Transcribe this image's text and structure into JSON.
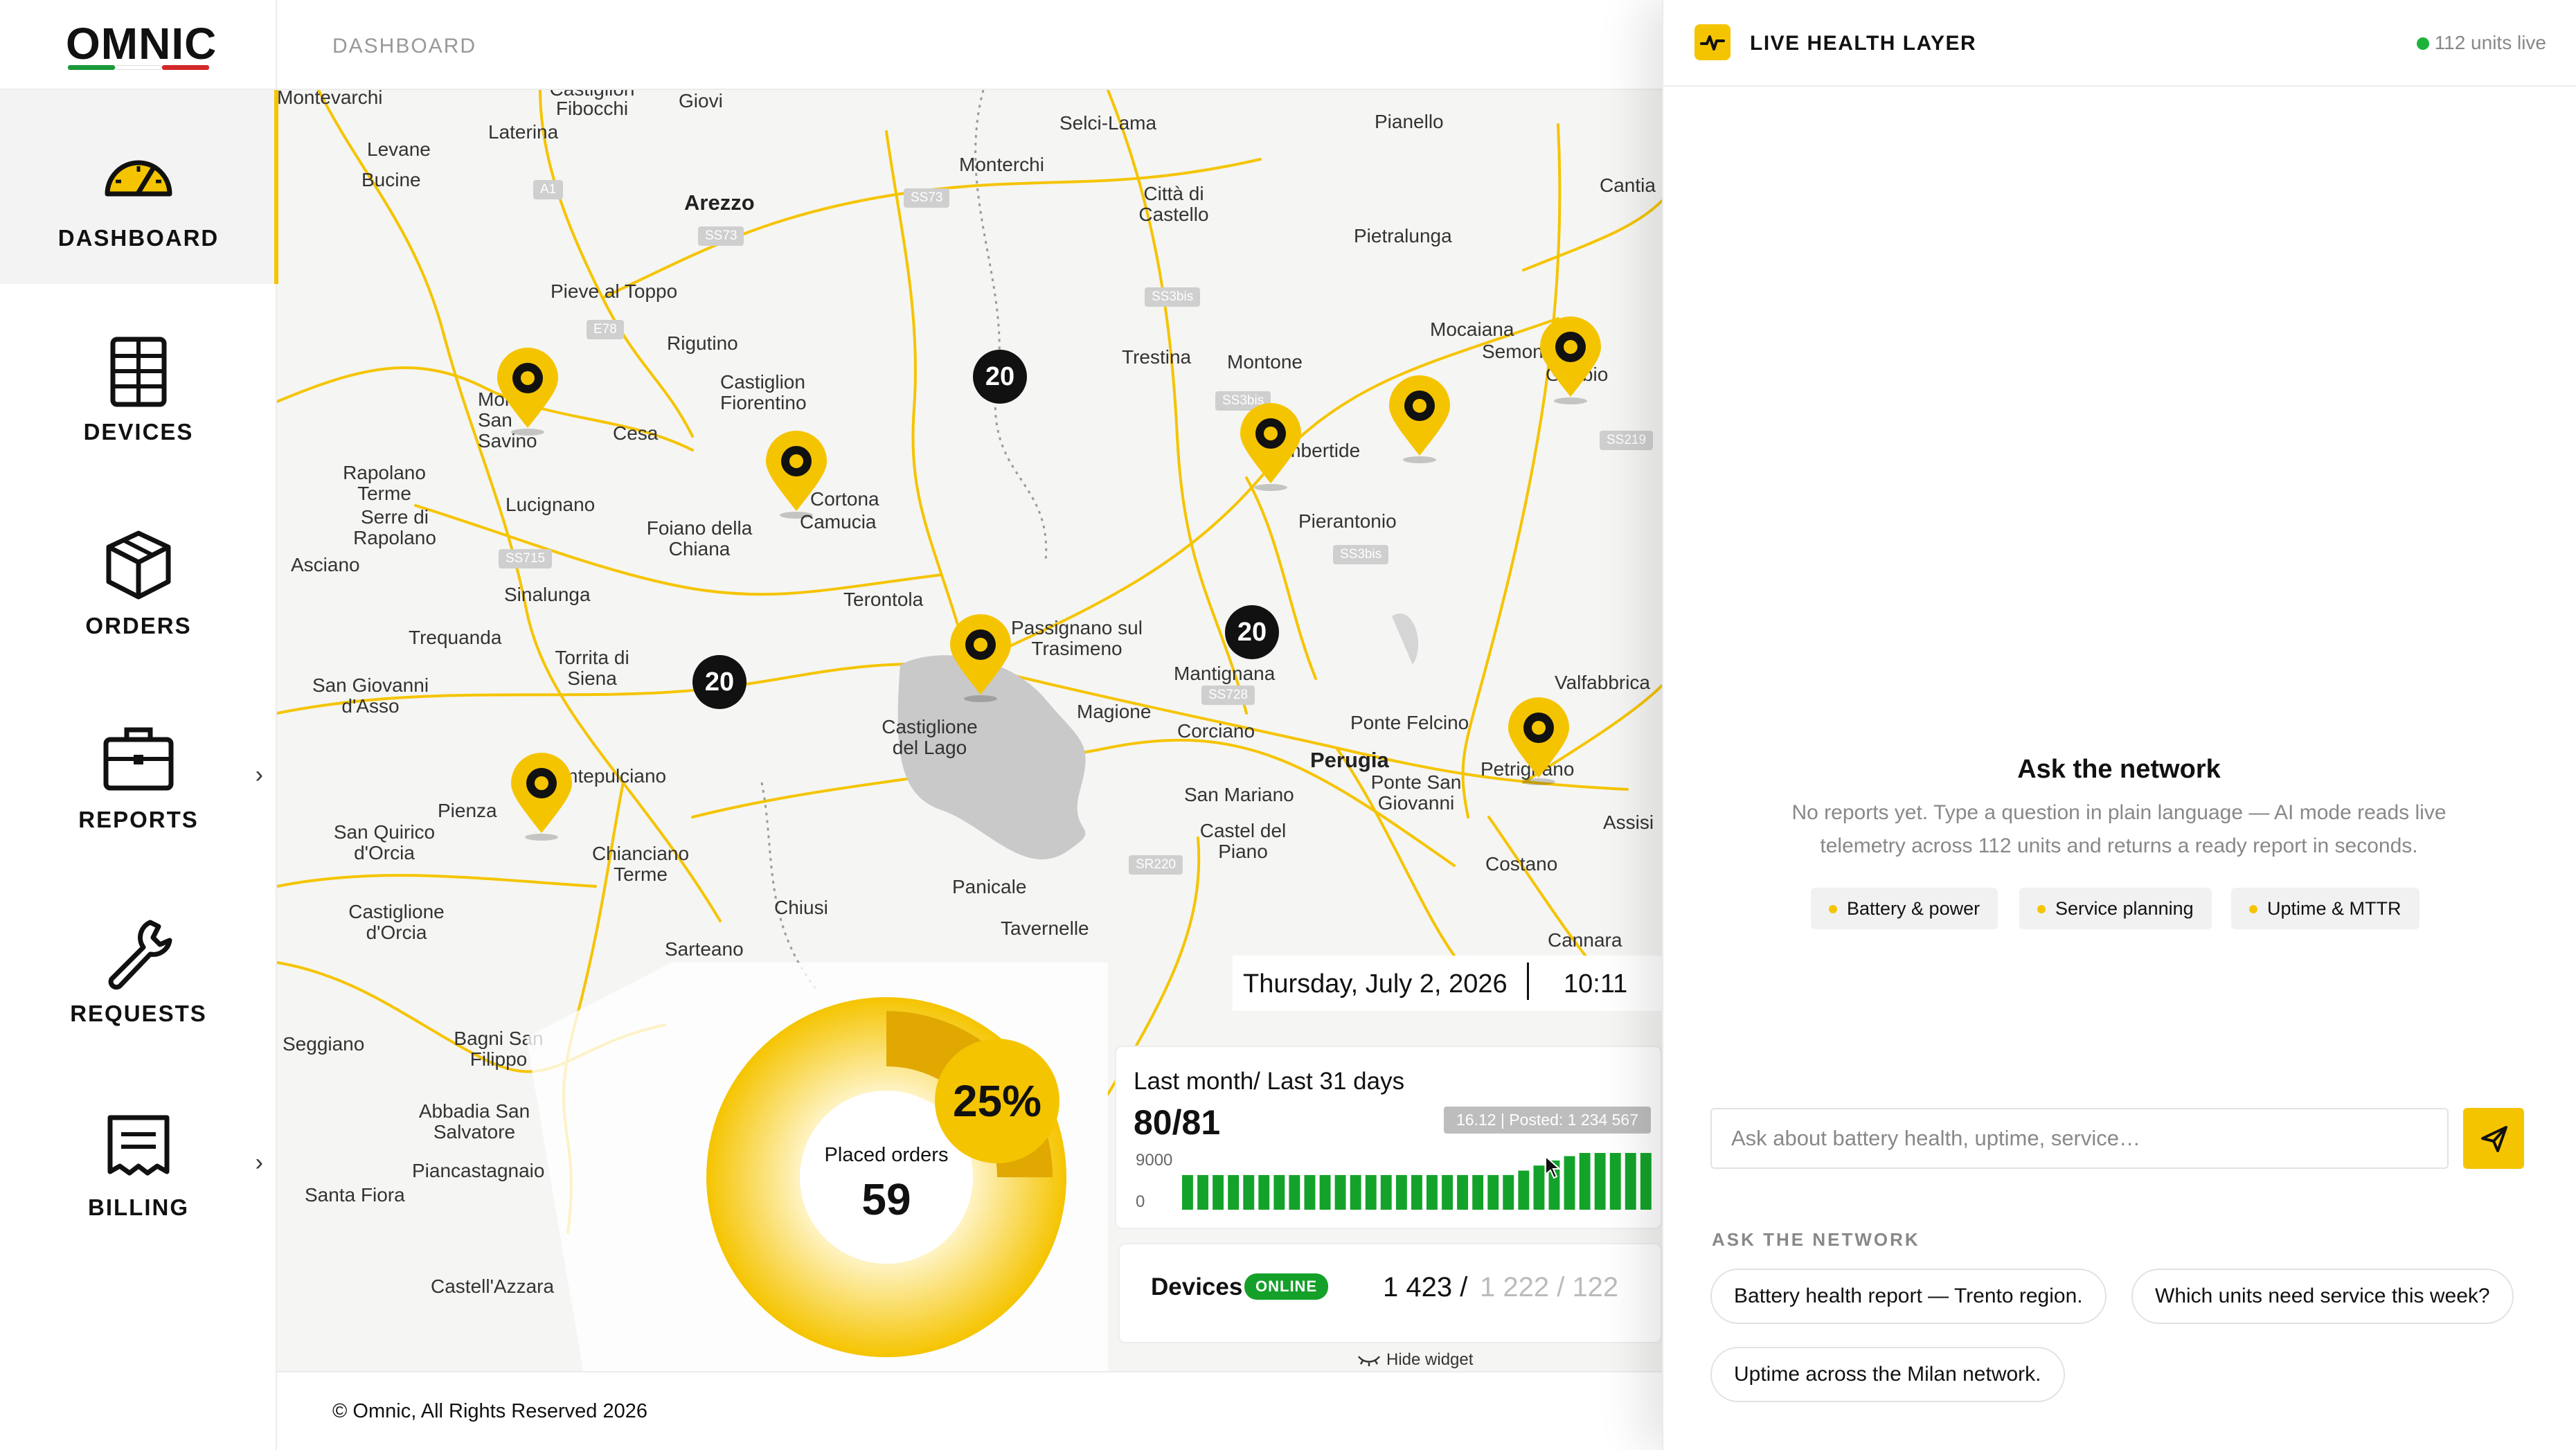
{
  "brand": {
    "name": "OMNIC",
    "flag_colors": [
      "#1a9a3a",
      "#ffffff",
      "#d22a2a"
    ]
  },
  "colors": {
    "accent": "#f5c400",
    "online": "#15a02a",
    "live_dot": "#1db33a"
  },
  "sidebar": {
    "items": [
      {
        "label": "DASHBOARD",
        "icon": "gauge-icon",
        "active": true
      },
      {
        "label": "DEVICES",
        "icon": "locker-icon"
      },
      {
        "label": "ORDERS",
        "icon": "box-icon"
      },
      {
        "label": "REPORTS",
        "icon": "briefcase-icon",
        "chevron": "›"
      },
      {
        "label": "REQUESTS",
        "icon": "wrench-icon"
      },
      {
        "label": "BILLING",
        "icon": "receipt-icon",
        "chevron": "›"
      }
    ]
  },
  "header": {
    "breadcrumb": "DASHBOARD"
  },
  "map": {
    "towns": [
      "Montevarchi",
      "Castiglion Fibocchi",
      "Giovi",
      "Laterina",
      "Levane",
      "Bucine",
      "Arezzo",
      "Selci-Lama",
      "Monterchi",
      "Città di Castello",
      "Pianello",
      "Cantia",
      "Pietralunga",
      "Pieve al Toppo",
      "Rigutino",
      "Castiglion Fiorentino",
      "Trestina",
      "Montone",
      "Mocaiana",
      "Semonte",
      "Gubbio",
      "Monte San Savino",
      "Cesa",
      "Cortona",
      "Camucia",
      "Umbertide",
      "Rapolano Terme",
      "Lucignano",
      "Serre di Rapolano",
      "Foiano della Chiana",
      "Asciano",
      "Pierantonio",
      "Sinalunga",
      "Terontola",
      "Trequanda",
      "Torrita di Siena",
      "Passignano sul Trasimeno",
      "Mantignana",
      "San Giovanni d'Asso",
      "Castiglione del Lago",
      "Magione",
      "Corciano",
      "Ponte Felcino",
      "Valfabbrica",
      "Perugia",
      "Petrignano",
      "Montepulciano",
      "Pienza",
      "Chianciano Terme",
      "San Quirico d'Orcia",
      "Castiglione d'Orcia",
      "San Mariano",
      "Castel del Piano",
      "Ponte San Giovanni",
      "Assisi",
      "Costano",
      "Chiusi",
      "Panicale",
      "Tavernelle",
      "Cannara",
      "Sarteano",
      "Seggiano",
      "Bagni San Filippo",
      "Abbadia San Salvatore",
      "Piancastagnaio",
      "Santa Fiora",
      "Castell'Azzara"
    ],
    "roads": [
      "A1",
      "SS73",
      "SS3bis",
      "E78",
      "SS715",
      "SS728",
      "SS219",
      "SR220"
    ],
    "clusters": [
      "20",
      "20",
      "20"
    ]
  },
  "widget": {
    "date": "Thursday, July 2, 2026",
    "time": "10:11",
    "donut": {
      "label": "Placed orders",
      "value": "59",
      "percent": "25%",
      "fill_fraction": 0.25
    },
    "stats": {
      "title": "Last month/ Last 31 days",
      "value": "80/81",
      "axis_top": "9000",
      "axis_bottom": "0",
      "tooltip": "16.12 | Posted: 1 234 567"
    },
    "devices": {
      "label": "Devices",
      "badge": "ONLINE",
      "count_primary": "1 423 /",
      "count_secondary": "1 222 / 122"
    },
    "hide_label": "Hide widget"
  },
  "chart_data": {
    "type": "bar",
    "title": "Last month/ Last 31 days",
    "ylim": [
      0,
      9000
    ],
    "values": [
      5500,
      5500,
      5500,
      5500,
      5500,
      5500,
      5500,
      5500,
      5500,
      5500,
      5500,
      5500,
      5500,
      5500,
      5500,
      5500,
      5500,
      5500,
      5500,
      5500,
      5500,
      5500,
      6200,
      7000,
      7800,
      8500,
      9000,
      9000,
      9000,
      9000,
      9000
    ]
  },
  "footer": {
    "copyright": "© Omnic, All Rights Reserved 2026"
  },
  "panel": {
    "title": "LIVE HEALTH LAYER",
    "live_status": "112 units live",
    "empty_title": "Ask the network",
    "empty_desc": "No reports yet. Type a question in plain language — AI mode reads live telemetry across 112 units and returns a ready report in seconds.",
    "chips": [
      "Battery & power",
      "Service planning",
      "Uptime & MTTR"
    ],
    "input_placeholder": "Ask about battery health, uptime, service…",
    "ask_caption": "ASK THE NETWORK",
    "suggestions": [
      "Battery health report — Trento region.",
      "Which units need service this week?",
      "Uptime across the Milan network."
    ]
  }
}
